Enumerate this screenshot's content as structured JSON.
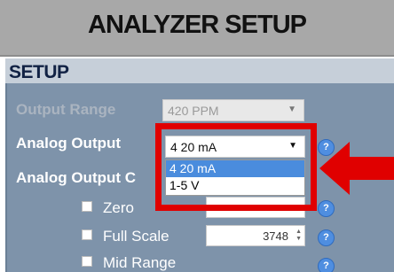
{
  "window": {
    "title": "ANALYZER SETUP"
  },
  "section": {
    "label": "SETUP"
  },
  "output_range": {
    "label": "Output Range",
    "value": "420 PPM"
  },
  "analog_output": {
    "label": "Analog Output",
    "value": "4 20 mA",
    "options": [
      "4 20 mA",
      "1-5 V"
    ],
    "selected_option": "4 20 mA"
  },
  "analog_output_c": {
    "label": "Analog Output C"
  },
  "checkboxes": [
    {
      "label": "Zero"
    },
    {
      "label": "Full Scale",
      "value": "3748"
    },
    {
      "label": "Mid Range"
    }
  ],
  "help_icon": "?",
  "colors": {
    "highlight": "#e00000",
    "panel": "#7e93aa",
    "selection": "#4a8cdd"
  }
}
